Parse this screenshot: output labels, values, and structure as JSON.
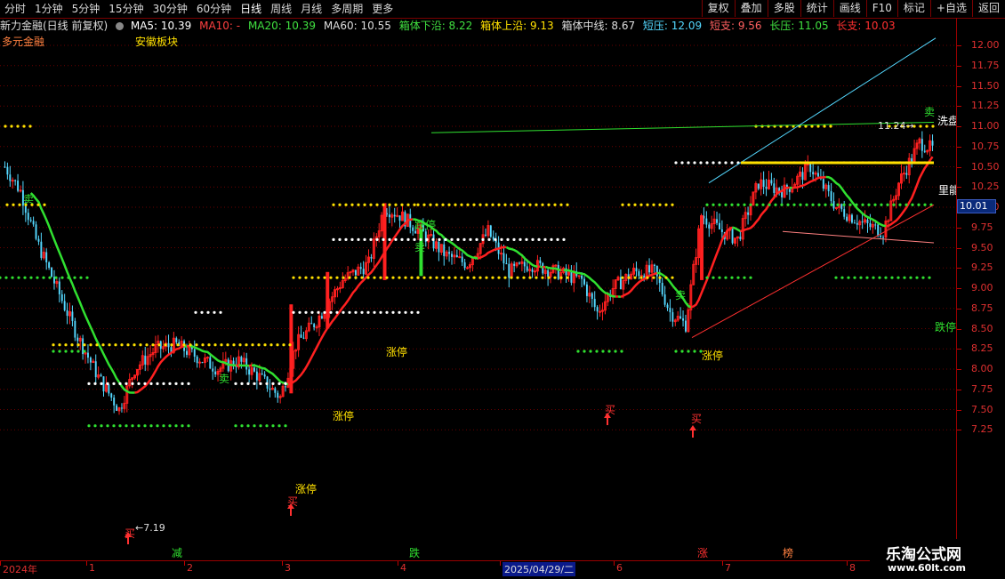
{
  "toolbar": {
    "period_tabs": [
      "分时",
      "1分钟",
      "5分钟",
      "15分钟",
      "30分钟",
      "60分钟",
      "日线",
      "周线",
      "月线",
      "多周期",
      "更多"
    ],
    "active_tab": "日线",
    "buttons": [
      "复权",
      "叠加",
      "多股",
      "统计",
      "画线",
      "F10",
      "标记",
      "+自选",
      "返回"
    ]
  },
  "info": {
    "title": "新力金融(日线 前复权)",
    "ma5": "MA5: 10.39",
    "ma10": "MA10: -",
    "ma20": "MA20: 10.39",
    "ma60": "MA60: 10.55",
    "box_low": "箱体下沿: 8.22",
    "box_high": "箱体上沿: 9.13",
    "box_mid": "箱体中线: 8.67",
    "short_res": "短压: 12.09",
    "short_sup": "短支: 9.56",
    "long_res": "长压: 11.05",
    "long_sup": "长支: 10.03",
    "concept": "多元金融",
    "region": "安徽板块"
  },
  "colors": {
    "up": "#ff2020",
    "down": "#54d8ff",
    "ma_red": "#ff2020",
    "ma_green": "#30e030",
    "yellow": "#ffe000",
    "axis": "#9a0000",
    "grid": "#7a0000"
  },
  "axis": {
    "y_ticks": [
      "12.00",
      "11.75",
      "11.50",
      "11.25",
      "11.00",
      "10.75",
      "10.50",
      "10.25",
      "10.00",
      "9.75",
      "9.50",
      "9.25",
      "9.00",
      "8.75",
      "8.50",
      "8.25",
      "8.00",
      "7.75",
      "7.50",
      "7.25"
    ],
    "current_price": "10.01",
    "x_labels": [
      "2024年",
      "1",
      "2",
      "3",
      "4",
      "2025/04/29/二",
      "6",
      "7",
      "8"
    ],
    "bottom_markers": [
      "减",
      "跌",
      "涨",
      "榜"
    ]
  },
  "annotations": {
    "buy": "买",
    "sell": "卖",
    "limit_up": "涨停",
    "limit_down": "跌停",
    "low_price": "7.19",
    "high_price": "11.24",
    "wash": "洗盘",
    "inside": "里能"
  },
  "chart_data": {
    "type": "candlestick",
    "ylim": [
      7.1,
      12.25
    ],
    "ma_lines": [
      "MA5",
      "MA10",
      "MA20",
      "MA60"
    ]
  },
  "watermark": {
    "line1": "乐淘公式网",
    "line2": "www.60lt.com"
  }
}
